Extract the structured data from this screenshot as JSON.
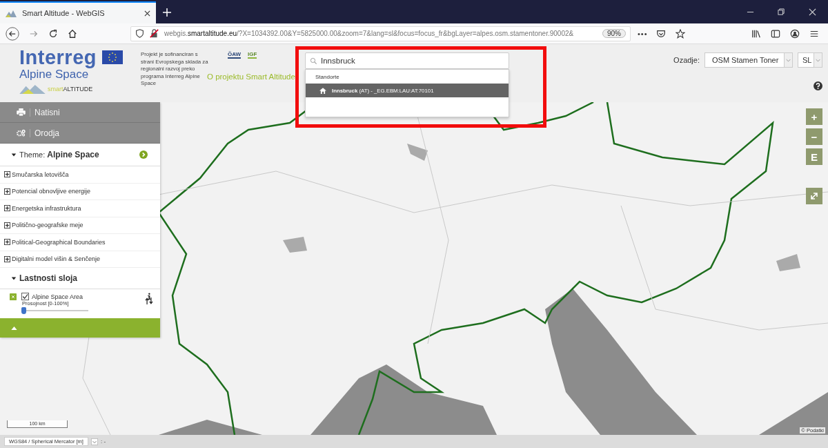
{
  "browser": {
    "tab_title": "Smart Altitude - WebGIS",
    "url_prefix": "webgis.",
    "url_domain": "smartaltitude.eu",
    "url_rest": "/?X=1034392.00&Y=5825000.00&zoom=7&lang=sl&focus=focus_fr&bgLayer=alpes.osm.stamentoner.90002&",
    "zoom": "90%",
    "menu_dots": "•••"
  },
  "header": {
    "logo_title": "Interreg",
    "logo_subtitle": "Alpine Space",
    "brand_light": "smart",
    "brand_caps": "ALTITUDE",
    "funding_text": "Projekt je sofinanciran s strani Evropskega sklada za regionalni razvoj preko programa Interreg Alpine Space",
    "partner_logos": [
      "ÖAW",
      "IGF"
    ],
    "about_link": "O projektu Smart Altitude"
  },
  "search": {
    "value": "Innsbruck",
    "group": "Standorte",
    "results": [
      {
        "name": "Innsbruck",
        "detail": "(AT) - _EG.EBM:LAU:AT:70101",
        "selected": true
      }
    ]
  },
  "background": {
    "label": "Ozadje:",
    "value": "OSM Stamen Toner"
  },
  "language": {
    "value": "SL"
  },
  "panel": {
    "buttons": [
      {
        "label": "Natisni",
        "kind": "print"
      },
      {
        "label": "Orodja",
        "kind": "tools"
      }
    ],
    "theme": {
      "label": "Theme:",
      "name": "Alpine Space",
      "expanded": true
    },
    "groups": [
      {
        "label": "Smučarska letovišča",
        "expanded": false
      },
      {
        "label": "Potencial obnovljive energije",
        "expanded": false
      },
      {
        "label": "Energetska infrastruktura",
        "expanded": false
      },
      {
        "label": "Politično-geografske meje",
        "expanded": false
      },
      {
        "label": "Political-Geographical Boundaries",
        "expanded": false
      },
      {
        "label": "Digitalni model višin & Senčenje",
        "expanded": false
      }
    ],
    "properties": {
      "title": "Lastnosti sloja",
      "expanded": true,
      "layer": {
        "name": "Alpine Space Area",
        "checked": true,
        "opacity_label": "Prosojnost [0-100%]",
        "level": 0.03
      }
    }
  },
  "map_controls": [
    "+",
    "−",
    "E"
  ],
  "scale": "100 km",
  "attribution": "© Podatki",
  "footer": {
    "projection": "WGS84 / Spherical Mercator [m]",
    "coordinates": ": -"
  }
}
